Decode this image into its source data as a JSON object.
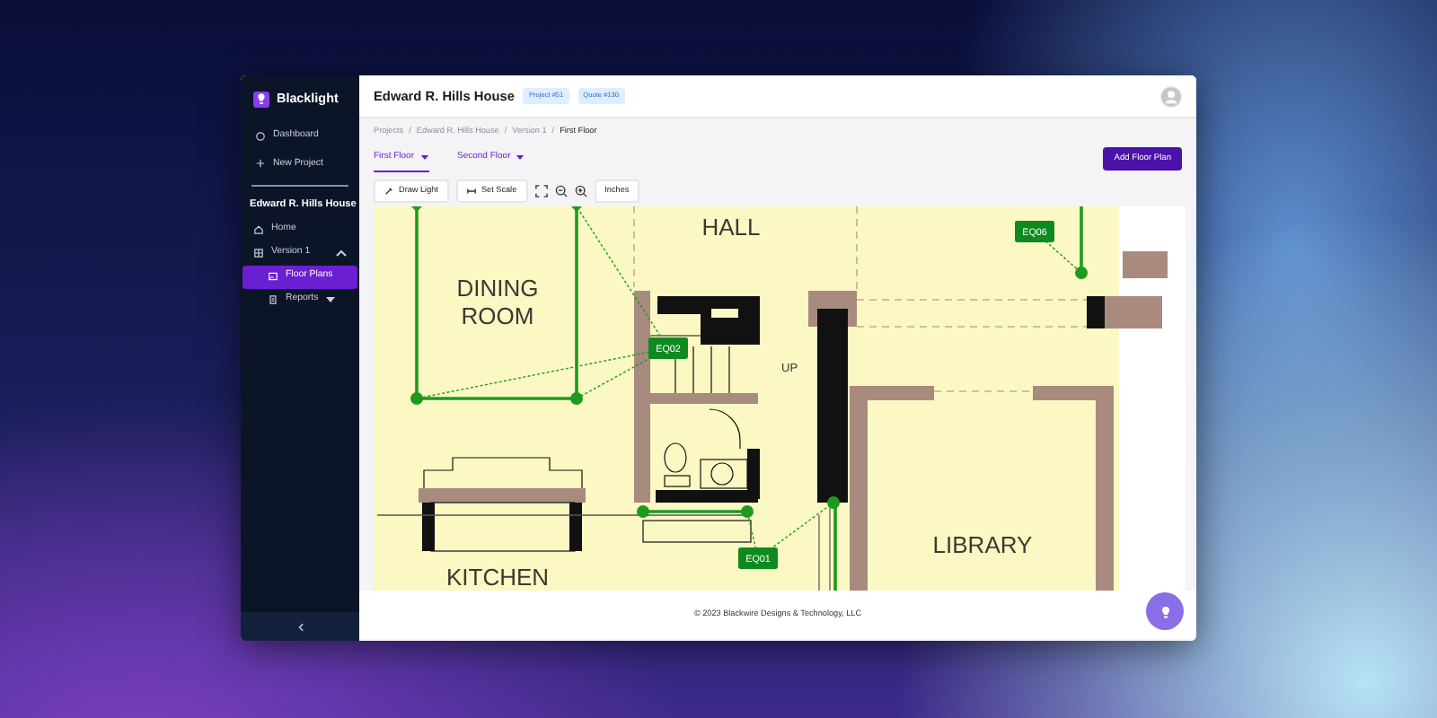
{
  "app": {
    "name": "Blacklight"
  },
  "sidebar": {
    "items": [
      {
        "label": "Dashboard",
        "kind": "dashboard"
      },
      {
        "label": "New Project",
        "kind": "plus"
      }
    ],
    "project_title": "Edward R. Hills House",
    "project_items": [
      {
        "label": "Home",
        "kind": "home",
        "selected": false
      },
      {
        "label": "Version 1",
        "kind": "grid",
        "selected": false,
        "expanded": true,
        "children": [
          {
            "label": "Floor Plans",
            "kind": "image",
            "selected": true
          },
          {
            "label": "Reports",
            "kind": "doc",
            "selected": false,
            "expanded": false
          }
        ]
      }
    ]
  },
  "header": {
    "title": "Edward R. Hills House",
    "badges": [
      "Project #51",
      "Quote #130"
    ]
  },
  "breadcrumb": [
    {
      "label": "Projects"
    },
    {
      "separator": "/",
      "label": "Edward R. Hills House"
    },
    {
      "separator": "/",
      "label": "Version 1"
    },
    {
      "separator": "/",
      "label": "First Floor"
    }
  ],
  "floor_tabs": [
    {
      "label": "First Floor",
      "selected": true
    },
    {
      "label": "Second Floor",
      "selected": false
    }
  ],
  "add_button": "Add Floor Plan",
  "toolbar": {
    "draw_light": "Draw Light",
    "set_scale": "Set Scale",
    "units": "Inches"
  },
  "floor_plan": {
    "rooms": [
      "HALL",
      "DINING ROOM",
      "UP",
      "LIBRARY",
      "KITCHEN"
    ],
    "markers": [
      "EQ06",
      "EQ02",
      "EQ01"
    ]
  },
  "footer": "© 2023 Blackwire Designs & Technology, LLC"
}
